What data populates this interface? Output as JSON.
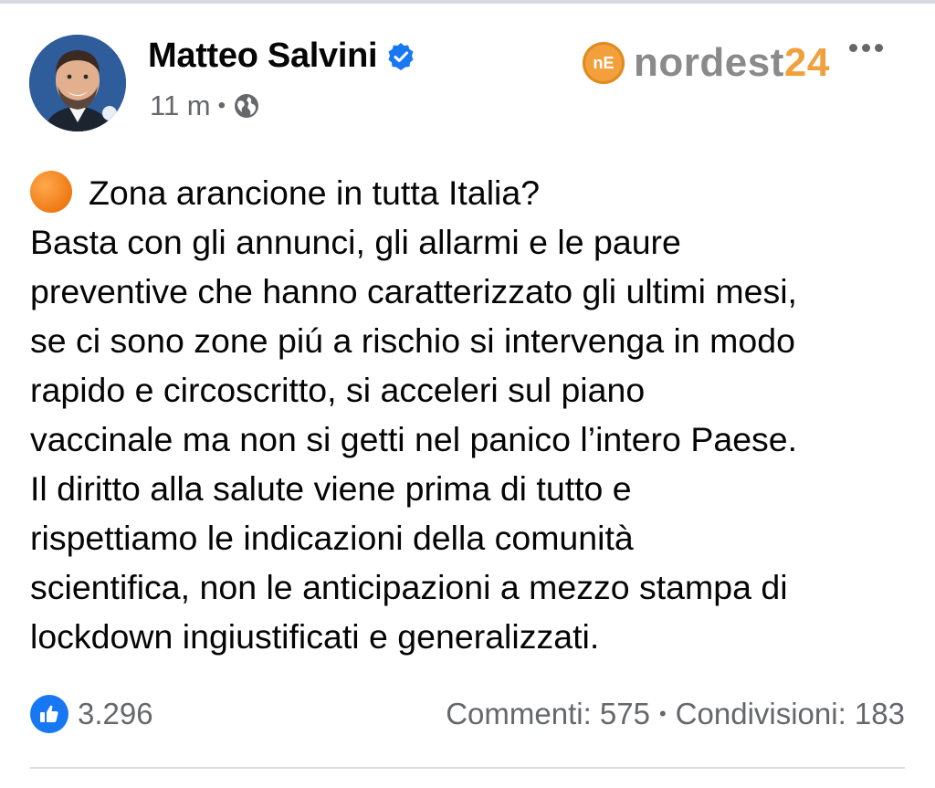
{
  "post": {
    "author": "Matteo Salvini",
    "time": "11 m",
    "separator": "•",
    "lines": [
      "Zona arancione in tutta Italia?",
      "Basta con gli annunci, gli allarmi e le paure",
      "preventive che hanno caratterizzato gli ultimi mesi,",
      "se ci sono zone piú a rischio si intervenga in modo",
      "rapido e circoscritto, si acceleri sul piano",
      "vaccinale ma non si getti nel panico l’intero Paese.",
      "Il diritto alla salute viene prima di tutto e",
      "rispettiamo le indicazioni della comunità",
      "scientifica, non le anticipazioni a mezzo stampa di",
      "lockdown ingiustificati e generalizzati."
    ]
  },
  "watermark": {
    "logo_letters": "nE",
    "text_main": "nordest",
    "text_num": "24"
  },
  "footer": {
    "likes": "3.296",
    "comments": "Commenti: 575",
    "separator": "•",
    "shares": "Condivisioni: 183"
  },
  "icons": {
    "verified": "verified-badge-icon",
    "audience": "globe-icon",
    "reaction": "like-icon",
    "emoji": "orange-circle-icon",
    "menu": "more-icon"
  },
  "colors": {
    "facebook_blue": "#1877f2",
    "secondary_text": "#65676b",
    "watermark_orange": "#f2a03c"
  }
}
